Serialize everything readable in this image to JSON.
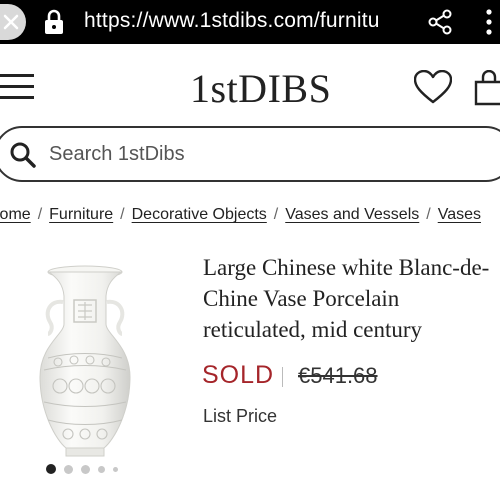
{
  "browser": {
    "url": "https://www.1stdibs.com/furnitu",
    "icons": [
      "close-icon",
      "lock-icon",
      "share-icon",
      "more-vert-icon"
    ]
  },
  "header": {
    "logo_text": "1stDIBS",
    "icons": [
      "menu-icon",
      "heart-icon",
      "cart-icon"
    ]
  },
  "search": {
    "placeholder": "Search 1stDibs"
  },
  "breadcrumbs": [
    "Home",
    "Furniture",
    "Decorative Objects",
    "Vases and Vessels",
    "Vases"
  ],
  "product": {
    "title_lines": [
      "Large Chinese white Blanc-de-",
      "Chine Vase Porcelain",
      "reticulated, mid century"
    ],
    "status": "SOLD",
    "price": "€541.68",
    "price_label": "List Price",
    "image_count": 5,
    "active_image": 1
  },
  "colors": {
    "sold": "#a5252a",
    "browser_bar": "#000000"
  }
}
